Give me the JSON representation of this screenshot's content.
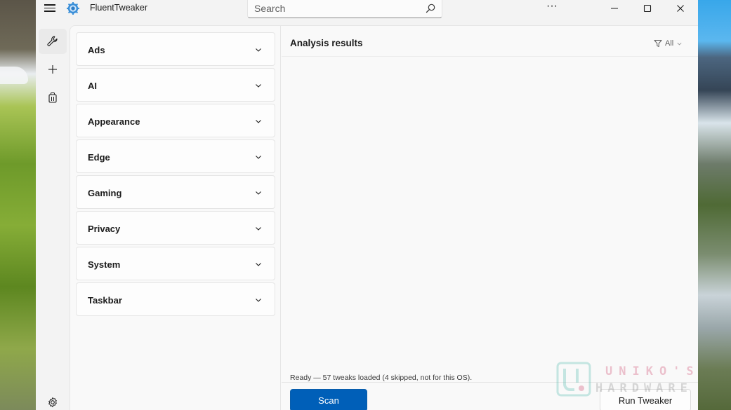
{
  "window": {
    "app_title": "FluentTweaker",
    "more_label": "···"
  },
  "search": {
    "placeholder": "Search",
    "value": ""
  },
  "categories": [
    {
      "label": "Ads"
    },
    {
      "label": "AI"
    },
    {
      "label": "Appearance"
    },
    {
      "label": "Edge"
    },
    {
      "label": "Gaming"
    },
    {
      "label": "Privacy"
    },
    {
      "label": "System"
    },
    {
      "label": "Taskbar"
    }
  ],
  "results": {
    "title": "Analysis results",
    "filter_label": "All",
    "status": "Ready — 57 tweaks loaded (4 skipped, not for this OS).",
    "scan_label": "Scan",
    "run_label": "Run Tweaker"
  },
  "nav": {
    "items": [
      {
        "icon": "wrench-icon",
        "selected": true
      },
      {
        "icon": "plus-icon",
        "selected": false
      },
      {
        "icon": "package-icon",
        "selected": false
      },
      {
        "icon": "gear-icon",
        "selected": false
      }
    ]
  },
  "watermark": {
    "line1": "UNIKO'S",
    "line2": "HARDWARE"
  },
  "colors": {
    "accent": "#005fb8",
    "window_bg": "#f3f3f3",
    "content_bg": "#f9f9f9"
  }
}
